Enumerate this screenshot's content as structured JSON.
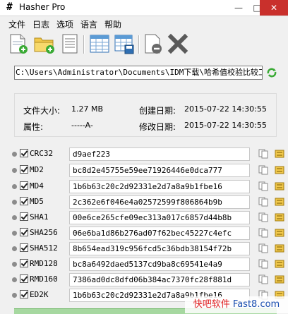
{
  "window": {
    "icon_glyph": "#",
    "title": "Hasher Pro"
  },
  "menubar": [
    "文件",
    "日志",
    "选项",
    "语言",
    "帮助"
  ],
  "toolbar": [
    "new-icon",
    "open-folder-icon",
    "document-icon",
    "table-icon",
    "save-table-icon",
    "remove-icon",
    "close-x-icon"
  ],
  "path": {
    "value": "C:\\Users\\Administrator\\Documents\\IDM下载\\哈希值校验比较工具"
  },
  "info": {
    "size_label": "文件大小:",
    "size_value": "1.27 MB",
    "attr_label": "属性:",
    "attr_value": "-----A-",
    "created_label": "创建日期:",
    "created_value": "2015-07-22 14:30:55",
    "modified_label": "修改日期:",
    "modified_value": "2015-07-22 14:30:55"
  },
  "hashes": [
    {
      "algo": "CRC32",
      "value": "d9aef223"
    },
    {
      "algo": "MD2",
      "value": "bc8d2e45755e59ee71926446e0dca777"
    },
    {
      "algo": "MD4",
      "value": "1b6b63c20c2d92331e2d7a8a9b1fbe16"
    },
    {
      "algo": "MD5",
      "value": "2c362e6f046e4a02572599f806864b9b"
    },
    {
      "algo": "SHA1",
      "value": "00e6ce265cfe09ec313a017c6857d44b8b"
    },
    {
      "algo": "SHA256",
      "value": "06e6ba1d86b276ad07f62bec45227c4efc"
    },
    {
      "algo": "SHA512",
      "value": "8b654ead319c956fcd5c36bdb38154f72b"
    },
    {
      "algo": "RMD128",
      "value": "bc8a6492daed5137cd9ba8c69541e4a9"
    },
    {
      "algo": "RMD160",
      "value": "7386ad0dc8dfd06b384ac7370fc28f881d"
    },
    {
      "algo": "ED2K",
      "value": "1b6b63c20c2d92331e2d7a8a9b1fbe16"
    }
  ],
  "watermark": {
    "part1": "快吧软件",
    "part2": "Fast8.com"
  },
  "colors": {
    "progress_fill": "#a6d8a0",
    "close_button": "#c9302c",
    "watermark_red": "#e02020",
    "watermark_blue": "#1a4fb0"
  }
}
